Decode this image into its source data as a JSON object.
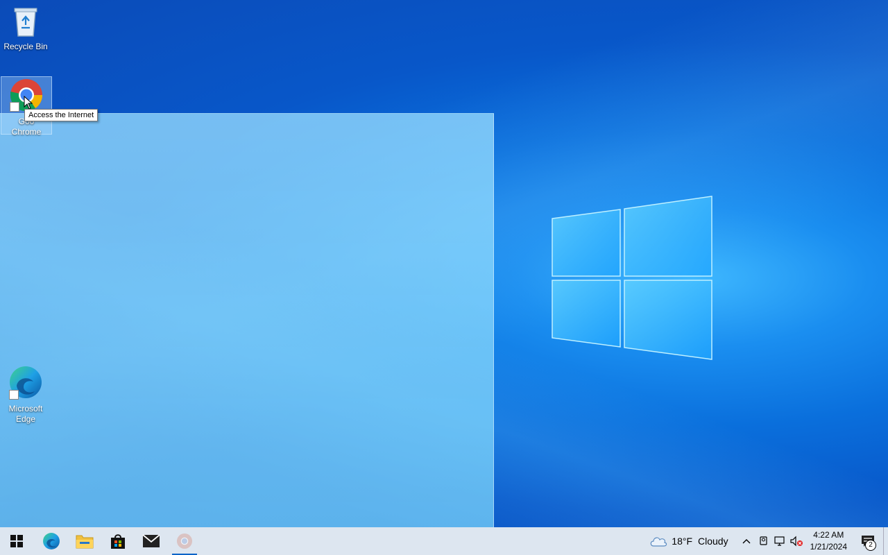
{
  "desktop": {
    "icons": [
      {
        "label": "Recycle Bin",
        "icon": "recycle-bin-icon"
      },
      {
        "label": "Google Chrome",
        "label_line1": "Goo",
        "label_line2": "Chrome",
        "icon": "chrome-icon",
        "selected": true
      },
      {
        "label": "Microsoft Edge",
        "label_line1": "Microsoft",
        "label_line2": "Edge",
        "icon": "edge-icon"
      }
    ],
    "tooltip": "Access the Internet"
  },
  "taskbar": {
    "pinned": [
      {
        "name": "start",
        "icon": "windows-start-icon"
      },
      {
        "name": "edge",
        "icon": "edge-icon"
      },
      {
        "name": "file-explorer",
        "icon": "folder-icon"
      },
      {
        "name": "store",
        "icon": "store-bag-icon"
      },
      {
        "name": "mail",
        "icon": "mail-icon"
      },
      {
        "name": "chrome",
        "icon": "chrome-icon",
        "active": true
      }
    ],
    "weather": {
      "temp": "18°F",
      "condition": "Cloudy",
      "icon": "cloud-icon"
    },
    "tray_icons": [
      "chevron-up-icon",
      "meet-now-icon",
      "network-icon",
      "volume-muted-icon"
    ],
    "clock": {
      "time": "4:22 AM",
      "date": "1/21/2024"
    },
    "notifications": {
      "count": "2",
      "icon": "action-center-icon"
    }
  },
  "colors": {
    "accent": "#0a64c8",
    "taskbar_bg": "#dde6f0"
  }
}
